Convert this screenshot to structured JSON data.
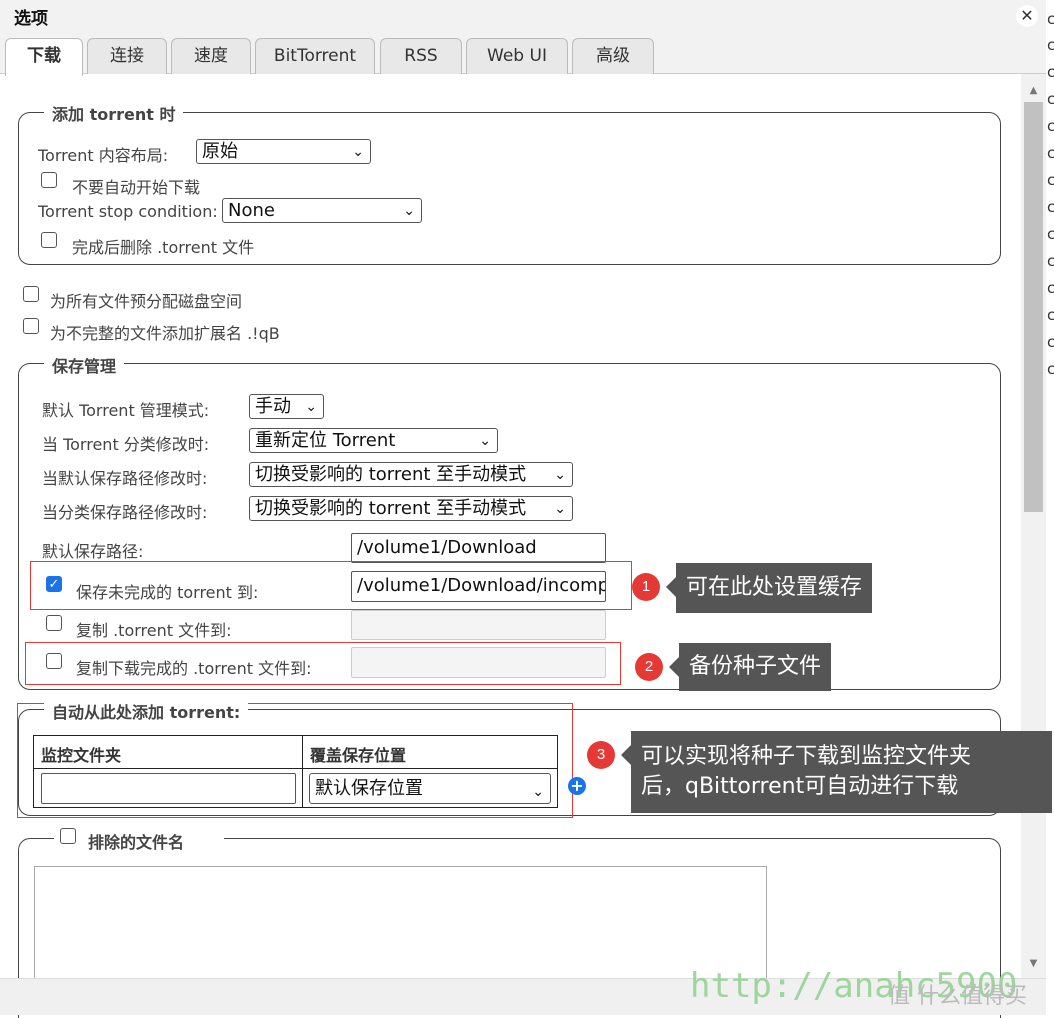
{
  "window": {
    "title": "选项"
  },
  "tabs": [
    "下载",
    "连接",
    "速度",
    "BitTorrent",
    "RSS",
    "Web UI",
    "高级"
  ],
  "right_strip_chars": [
    "c",
    "c",
    "c",
    "c",
    "c",
    "c",
    "c",
    "c",
    "c",
    "c",
    "c",
    "c",
    "c",
    "c"
  ],
  "add_torrent": {
    "legend": "添加 torrent 时",
    "layout_label": "Torrent 内容布局:",
    "layout_value": "原始",
    "dont_start_label": "不要自动开始下载",
    "stop_condition_label": "Torrent stop condition:",
    "stop_condition_value": "None",
    "delete_after_label": "完成后删除 .torrent 文件"
  },
  "preallocate_label": "为所有文件预分配磁盘空间",
  "append_ext_label": "为不完整的文件添加扩展名 .!qB",
  "saving": {
    "legend": "保存管理",
    "mode_label": "默认 Torrent 管理模式:",
    "mode_value": "手动",
    "cat_changed_label": "当 Torrent 分类修改时:",
    "cat_changed_value": "重新定位 Torrent",
    "default_path_changed_label": "当默认保存路径修改时:",
    "default_path_changed_value": "切换受影响的 torrent 至手动模式",
    "cat_path_changed_label": "当分类保存路径修改时:",
    "cat_path_changed_value": "切换受影响的 torrent 至手动模式",
    "default_path_label": "默认保存路径:",
    "default_path_value": "/volume1/Download",
    "incomplete_label": "保存未完成的 torrent 到:",
    "incomplete_value": "/volume1/Download/incomp",
    "copy_torrent_label": "复制 .torrent 文件到:",
    "copy_finished_label": "复制下载完成的 .torrent 文件到:"
  },
  "watch": {
    "legend": "自动从此处添加 torrent:",
    "col_folder": "监控文件夹",
    "col_override": "覆盖保存位置",
    "override_value": "默认保存位置"
  },
  "excluded": {
    "legend": "排除的文件名"
  },
  "callouts": {
    "c1_num": "1",
    "c1_text": "可在此处设置缓存",
    "c2_num": "2",
    "c2_text": "备份种子文件",
    "c3_num": "3",
    "c3_line1": "可以实现将种子下载到监控文件夹",
    "c3_line2": "后，qBittorrent可自动进行下载"
  },
  "watermark": {
    "url": "http://anahc5900",
    "site": "值 什么值得买"
  },
  "colors": {
    "accent": "#1a73e8",
    "annotation_red": "#e53935",
    "callout_bg": "#555555"
  }
}
